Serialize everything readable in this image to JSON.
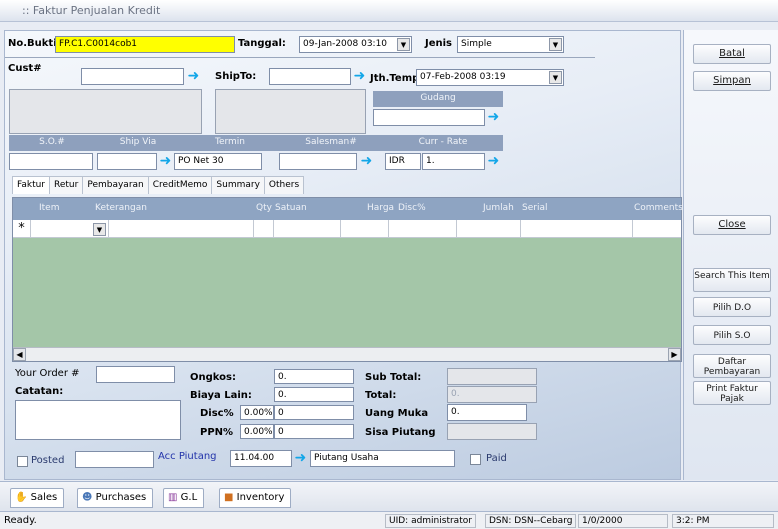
{
  "window": {
    "title": ":: Faktur Penjualan Kredit"
  },
  "header": {
    "nobukti_label": "No.Bukti#",
    "nobukti_value": "FP.C1.C0014cob1",
    "tanggal_label": "Tanggal:",
    "tanggal_value": "09-Jan-2008 03:10",
    "jenis_label": "Jenis",
    "jenis_value": "Simple",
    "cust_label": "Cust#",
    "shipto_label": "ShipTo:",
    "jthtempo_label": "Jth.Tempo",
    "jthtempo_value": "07-Feb-2008 03:19",
    "gudang_label": "Gudang"
  },
  "order_columns": {
    "so_label": "S.O.#",
    "shipvia_label": "Ship Via",
    "termin_label": "Termin",
    "salesman_label": "Salesman#",
    "currrate_label": "Curr - Rate",
    "termin_value": "PO Net 30",
    "curr_value": "IDR",
    "rate_value": "1."
  },
  "tabs": [
    "Faktur",
    "Retur",
    "Pembayaran",
    "CreditMemo",
    "Summary",
    "Others"
  ],
  "grid": {
    "columns": [
      "Item",
      "Keterangan",
      "Qty",
      "Satuan",
      "Harga",
      "Disc%",
      "Jumlah",
      "Serial",
      "Comments"
    ],
    "new_row_marker": "*"
  },
  "footer": {
    "yourorder_label": "Your Order #",
    "catatan_label": "Catatan:",
    "ongkos_label": "Ongkos:",
    "ongkos_value": "0.",
    "biayalain_label": "Biaya Lain:",
    "biayalain_value": "0.",
    "disc_label": "Disc%",
    "disc_pct": "0.00%",
    "disc_value": "0",
    "ppn_label": "PPN%",
    "ppn_pct": "0.00%",
    "ppn_value": "0",
    "subtotal_label": "Sub Total:",
    "total_label": "Total:",
    "total_value": "0.",
    "uangmuka_label": "Uang Muka",
    "uangmuka_value": "0.",
    "sisapiutang_label": "Sisa Piutang",
    "posted_label": "Posted",
    "accpiutang_label": "Acc Piutang",
    "accpiutang_code": "11.04.00",
    "accpiutang_name": "Piutang Usaha",
    "paid_label": "Paid"
  },
  "buttons": {
    "batal": "Batal",
    "simpan": "Simpan",
    "close": "Close",
    "search_item": "Search This Item",
    "pilih_do": "Pilih D.O",
    "pilih_so": "Pilih S.O",
    "daftar_pembayaran": "Daftar Pembayaran",
    "print_faktur_pajak": "Print Faktur Pajak"
  },
  "bottom_tabs": [
    "Sales",
    "Purchases",
    "G.L",
    "Inventory"
  ],
  "statusbar": {
    "ready": "Ready.",
    "uid": "UID: administrator",
    "dsn": "DSN: DSN--Cebarg",
    "date": "1/0/2000",
    "time": "3:2: PM"
  },
  "colors": {
    "nobukti_bg": "#ffff00",
    "arrow": "#12a6e8",
    "grid_empty": "#a4c6a8"
  }
}
